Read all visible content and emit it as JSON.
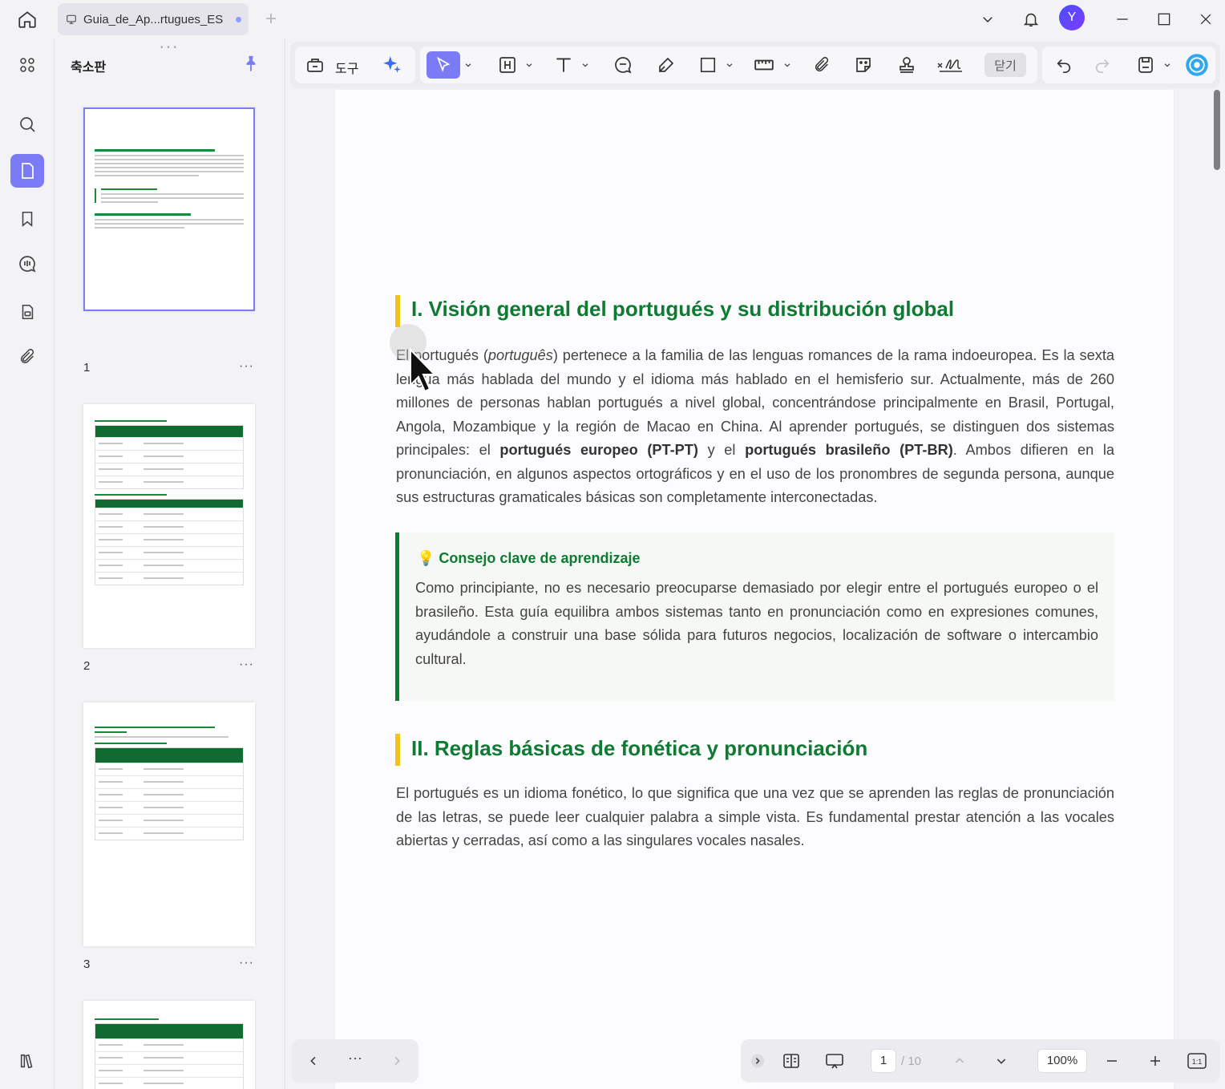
{
  "tab": {
    "title": "Guia_de_Ap...rtugues_ES"
  },
  "user": {
    "avatar_letter": "Y"
  },
  "panel": {
    "title": "축소판",
    "pages": [
      {
        "number": "1",
        "more": "···"
      },
      {
        "number": "2",
        "more": "···"
      },
      {
        "number": "3",
        "more": "···"
      }
    ]
  },
  "toolbar": {
    "tools_label": "도구",
    "close_label": "닫기"
  },
  "document": {
    "section1_title": "I. Visión general del portugués y su distribución global",
    "para1_a": "El portugués (",
    "para1_italic": "português",
    "para1_b": ") pertenece a la familia de las lenguas romances de la rama indoeuropea. Es la sexta lengua más hablada del mundo y el idioma más hablado en el hemisferio sur. Actualmente, más de 260 millones de personas hablan portugués a nivel global, concentrándose principalmente en Brasil, Portugal, Angola, Mozambique y la región de Macao en China. Al aprender portugués, se distinguen dos sistemas principales: el ",
    "para1_bold1": "portugués europeo (PT-PT)",
    "para1_c": " y el ",
    "para1_bold2": "portugués brasileño (PT-BR)",
    "para1_d": ". Ambos difieren en la pronunciación, en algunos aspectos ortográficos y en el uso de los pronombres de segunda persona, aunque sus estructuras gramaticales básicas son completamente interconectadas.",
    "tip_title": "💡 Consejo clave de aprendizaje",
    "tip_body": "Como principiante, no es necesario preocuparse demasiado por elegir entre el portugués europeo o el brasileño. Esta guía equilibra ambos sistemas tanto en pronunciación como en expresiones comunes, ayudándole a construir una base sólida para futuros negocios, localización de software o intercambio cultural.",
    "section2_title": "II. Reglas básicas de fonética y pronunciación",
    "para2": "El portugués es un idioma fonético, lo que significa que una vez que se aprenden las reglas de pronunciación de las letras, se puede leer cualquier palabra a simple vista. Es fundamental prestar atención a las vocales abiertas y cerradas, así como a las singulares vocales nasales."
  },
  "navigation": {
    "more": "···"
  },
  "pager": {
    "current_page": "1",
    "total": "/ 10",
    "zoom": "100%"
  },
  "colors": {
    "accent": "#7b7cf5",
    "heading_green": "#0e7a32",
    "heading_bar": "#f2c318"
  }
}
